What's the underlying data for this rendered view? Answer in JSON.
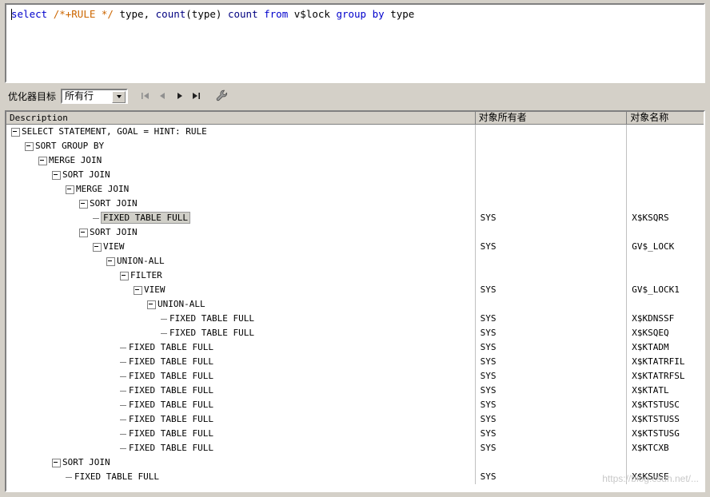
{
  "editor": {
    "sql_tokens": [
      {
        "t": "select ",
        "c": "kw"
      },
      {
        "t": "/*+RULE */",
        "c": "hint"
      },
      {
        "t": " type, ",
        "c": "plain"
      },
      {
        "t": "count",
        "c": "fn"
      },
      {
        "t": "(type) ",
        "c": "plain"
      },
      {
        "t": "count ",
        "c": "fn"
      },
      {
        "t": "from ",
        "c": "kw"
      },
      {
        "t": "v$lock ",
        "c": "plain"
      },
      {
        "t": "group by ",
        "c": "kw"
      },
      {
        "t": "type",
        "c": "plain"
      }
    ],
    "sql_text": "select /*+RULE */ type, count(type) count from v$lock group by type"
  },
  "toolbar": {
    "optimizer_label": "优化器目标",
    "optimizer_value": "所有行",
    "optimizer_options": [
      "所有行"
    ],
    "nav": {
      "first": "|◀",
      "prev": "◀",
      "next": "▶",
      "last": "▶|",
      "tools": "wrench-icon"
    }
  },
  "grid": {
    "columns": [
      "Description",
      "对象所有者",
      "对象名称"
    ],
    "rows": [
      {
        "indent": 0,
        "mark": "expand",
        "label": "SELECT STATEMENT, GOAL = HINT: RULE",
        "owner": "",
        "name": "",
        "selected": false
      },
      {
        "indent": 1,
        "mark": "expand",
        "label": "SORT GROUP BY",
        "owner": "",
        "name": "",
        "selected": false
      },
      {
        "indent": 2,
        "mark": "expand",
        "label": "MERGE JOIN",
        "owner": "",
        "name": "",
        "selected": false
      },
      {
        "indent": 3,
        "mark": "expand",
        "label": "SORT JOIN",
        "owner": "",
        "name": "",
        "selected": false
      },
      {
        "indent": 4,
        "mark": "expand",
        "label": "MERGE JOIN",
        "owner": "",
        "name": "",
        "selected": false
      },
      {
        "indent": 5,
        "mark": "expand",
        "label": "SORT JOIN",
        "owner": "",
        "name": "",
        "selected": false
      },
      {
        "indent": 6,
        "mark": "leaf",
        "label": "FIXED TABLE FULL",
        "owner": "SYS",
        "name": "X$KSQRS",
        "selected": true
      },
      {
        "indent": 5,
        "mark": "expand",
        "label": "SORT JOIN",
        "owner": "",
        "name": "",
        "selected": false
      },
      {
        "indent": 6,
        "mark": "expand",
        "label": "VIEW",
        "owner": "SYS",
        "name": "GV$_LOCK",
        "selected": false
      },
      {
        "indent": 7,
        "mark": "expand",
        "label": "UNION-ALL",
        "owner": "",
        "name": "",
        "selected": false
      },
      {
        "indent": 8,
        "mark": "expand",
        "label": "FILTER",
        "owner": "",
        "name": "",
        "selected": false
      },
      {
        "indent": 9,
        "mark": "expand",
        "label": "VIEW",
        "owner": "SYS",
        "name": "GV$_LOCK1",
        "selected": false
      },
      {
        "indent": 10,
        "mark": "expand",
        "label": "UNION-ALL",
        "owner": "",
        "name": "",
        "selected": false
      },
      {
        "indent": 11,
        "mark": "leaf",
        "label": "FIXED TABLE FULL",
        "owner": "SYS",
        "name": "X$KDNSSF",
        "selected": false
      },
      {
        "indent": 11,
        "mark": "leaf",
        "label": "FIXED TABLE FULL",
        "owner": "SYS",
        "name": "X$KSQEQ",
        "selected": false
      },
      {
        "indent": 8,
        "mark": "leaf",
        "label": "FIXED TABLE FULL",
        "owner": "SYS",
        "name": "X$KTADM",
        "selected": false
      },
      {
        "indent": 8,
        "mark": "leaf",
        "label": "FIXED TABLE FULL",
        "owner": "SYS",
        "name": "X$KTATRFIL",
        "selected": false
      },
      {
        "indent": 8,
        "mark": "leaf",
        "label": "FIXED TABLE FULL",
        "owner": "SYS",
        "name": "X$KTATRFSL",
        "selected": false
      },
      {
        "indent": 8,
        "mark": "leaf",
        "label": "FIXED TABLE FULL",
        "owner": "SYS",
        "name": "X$KTATL",
        "selected": false
      },
      {
        "indent": 8,
        "mark": "leaf",
        "label": "FIXED TABLE FULL",
        "owner": "SYS",
        "name": "X$KTSTUSC",
        "selected": false
      },
      {
        "indent": 8,
        "mark": "leaf",
        "label": "FIXED TABLE FULL",
        "owner": "SYS",
        "name": "X$KTSTUSS",
        "selected": false
      },
      {
        "indent": 8,
        "mark": "leaf",
        "label": "FIXED TABLE FULL",
        "owner": "SYS",
        "name": "X$KTSTUSG",
        "selected": false
      },
      {
        "indent": 8,
        "mark": "leaf",
        "label": "FIXED TABLE FULL",
        "owner": "SYS",
        "name": "X$KTCXB",
        "selected": false
      },
      {
        "indent": 3,
        "mark": "expand",
        "label": "SORT JOIN",
        "owner": "",
        "name": "",
        "selected": false
      },
      {
        "indent": 4,
        "mark": "leaf",
        "label": "FIXED TABLE FULL",
        "owner": "SYS",
        "name": "X$KSUSE",
        "selected": false
      }
    ]
  },
  "watermark": "https://blog.csdn.net/..."
}
